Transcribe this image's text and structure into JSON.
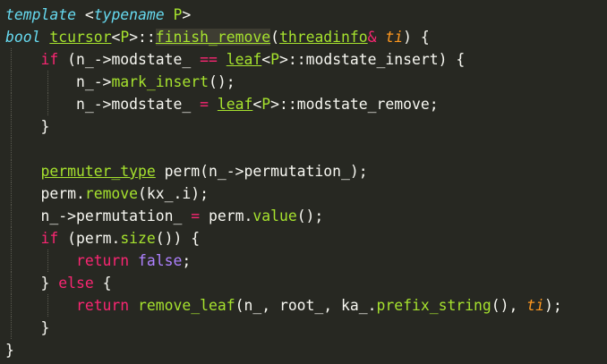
{
  "editor": {
    "lines": [
      {
        "indent": 0,
        "tokens": [
          {
            "t": "template",
            "c": "kwi"
          },
          {
            "t": " <",
            "c": "pl"
          },
          {
            "t": "typename",
            "c": "kwi"
          },
          {
            "t": " ",
            "c": "pl"
          },
          {
            "t": "P",
            "c": "tparam"
          },
          {
            "t": ">",
            "c": "pl"
          }
        ]
      },
      {
        "indent": 0,
        "tokens": [
          {
            "t": "bool",
            "c": "kwi"
          },
          {
            "t": " ",
            "c": "pl"
          },
          {
            "t": "tcursor",
            "c": "ty"
          },
          {
            "t": "<",
            "c": "pl"
          },
          {
            "t": "P",
            "c": "tparam"
          },
          {
            "t": ">::",
            "c": "pl"
          },
          {
            "t": "finish_remove",
            "c": "fnhl"
          },
          {
            "t": "(",
            "c": "pl"
          },
          {
            "t": "threadinfo",
            "c": "ty"
          },
          {
            "t": "&",
            "c": "op"
          },
          {
            "t": " ",
            "c": "pl"
          },
          {
            "t": "ti",
            "c": "param"
          },
          {
            "t": ") {",
            "c": "pl"
          }
        ]
      },
      {
        "indent": 1,
        "tokens": [
          {
            "t": "if",
            "c": "kw"
          },
          {
            "t": " (n_->modstate_ ",
            "c": "pl"
          },
          {
            "t": "==",
            "c": "op"
          },
          {
            "t": " ",
            "c": "pl"
          },
          {
            "t": "leaf",
            "c": "ty"
          },
          {
            "t": "<",
            "c": "pl"
          },
          {
            "t": "P",
            "c": "tparam"
          },
          {
            "t": ">::modstate_insert) {",
            "c": "pl"
          }
        ]
      },
      {
        "indent": 2,
        "tokens": [
          {
            "t": "n_->",
            "c": "pl"
          },
          {
            "t": "mark_insert",
            "c": "fn"
          },
          {
            "t": "();",
            "c": "pl"
          }
        ]
      },
      {
        "indent": 2,
        "tokens": [
          {
            "t": "n_->modstate_ ",
            "c": "pl"
          },
          {
            "t": "=",
            "c": "op"
          },
          {
            "t": " ",
            "c": "pl"
          },
          {
            "t": "leaf",
            "c": "ty"
          },
          {
            "t": "<",
            "c": "pl"
          },
          {
            "t": "P",
            "c": "tparam"
          },
          {
            "t": ">::modstate_remove;",
            "c": "pl"
          }
        ]
      },
      {
        "indent": 1,
        "tokens": [
          {
            "t": "}",
            "c": "pl"
          }
        ]
      },
      {
        "indent": 1,
        "tokens": []
      },
      {
        "indent": 1,
        "tokens": [
          {
            "t": "permuter_type",
            "c": "ty"
          },
          {
            "t": " perm(n_->permutation_);",
            "c": "pl"
          }
        ]
      },
      {
        "indent": 1,
        "tokens": [
          {
            "t": "perm.",
            "c": "pl"
          },
          {
            "t": "remove",
            "c": "fn"
          },
          {
            "t": "(kx_.i);",
            "c": "pl"
          }
        ]
      },
      {
        "indent": 1,
        "tokens": [
          {
            "t": "n_->permutation_ ",
            "c": "pl"
          },
          {
            "t": "=",
            "c": "op"
          },
          {
            "t": " perm.",
            "c": "pl"
          },
          {
            "t": "value",
            "c": "fn"
          },
          {
            "t": "();",
            "c": "pl"
          }
        ]
      },
      {
        "indent": 1,
        "tokens": [
          {
            "t": "if",
            "c": "kw"
          },
          {
            "t": " (perm.",
            "c": "pl"
          },
          {
            "t": "size",
            "c": "fn"
          },
          {
            "t": "()) {",
            "c": "pl"
          }
        ]
      },
      {
        "indent": 2,
        "tokens": [
          {
            "t": "return",
            "c": "kw"
          },
          {
            "t": " ",
            "c": "pl"
          },
          {
            "t": "false",
            "c": "con"
          },
          {
            "t": ";",
            "c": "pl"
          }
        ]
      },
      {
        "indent": 1,
        "tokens": [
          {
            "t": "} ",
            "c": "pl"
          },
          {
            "t": "else",
            "c": "kw"
          },
          {
            "t": " {",
            "c": "pl"
          }
        ]
      },
      {
        "indent": 2,
        "tokens": [
          {
            "t": "return",
            "c": "kw"
          },
          {
            "t": " ",
            "c": "pl"
          },
          {
            "t": "remove_leaf",
            "c": "fn"
          },
          {
            "t": "(n_, root_, ka_.",
            "c": "pl"
          },
          {
            "t": "prefix_string",
            "c": "fn"
          },
          {
            "t": "(), ",
            "c": "pl"
          },
          {
            "t": "ti",
            "c": "param"
          },
          {
            "t": ");",
            "c": "pl"
          }
        ]
      },
      {
        "indent": 1,
        "tokens": [
          {
            "t": "}",
            "c": "pl"
          }
        ]
      },
      {
        "indent": 0,
        "tokens": [
          {
            "t": "}",
            "c": "pl"
          }
        ]
      }
    ]
  },
  "theme": {
    "background": "#272822",
    "keyword": "#f92672",
    "storage": "#66d9ef",
    "entity": "#a6e22e",
    "parameter": "#fd971f",
    "constant": "#ae81ff",
    "text": "#f8f8f2"
  }
}
